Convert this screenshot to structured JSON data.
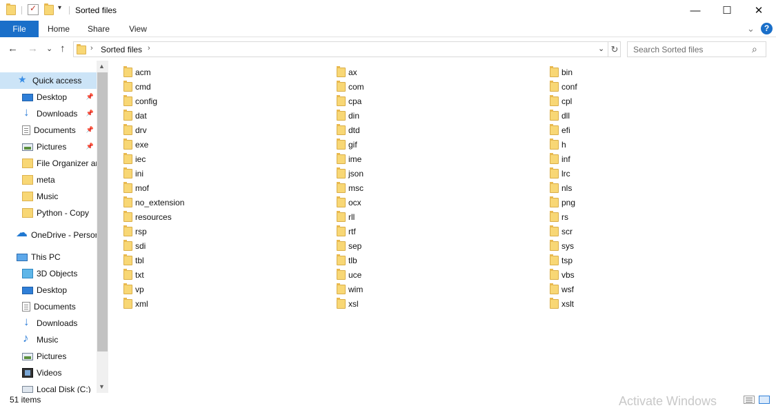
{
  "window": {
    "title": "Sorted files",
    "minimize": "—",
    "maximize": "☐",
    "close": "✕"
  },
  "quick_access_toolbar": {
    "dropdown": "▾"
  },
  "ribbon": {
    "tabs": [
      {
        "label": "File"
      },
      {
        "label": "Home"
      },
      {
        "label": "Share"
      },
      {
        "label": "View"
      }
    ],
    "expand": "⌄",
    "help": "?"
  },
  "navigation": {
    "back": "←",
    "forward": "→",
    "recent": "⌄",
    "up": "↑"
  },
  "address_bar": {
    "separator": "›",
    "breadcrumb": "Sorted files",
    "trailing_separator": "›",
    "dropdown": "⌄",
    "refresh": "↻"
  },
  "search": {
    "placeholder": "Search Sorted files",
    "icon": "⌕"
  },
  "nav_pane": {
    "scroll_up": "▲",
    "scroll_down": "▼",
    "items": [
      {
        "label": "Quick access",
        "icon": "star-icon",
        "selected": true
      },
      {
        "label": "Desktop",
        "icon": "desktop-icon",
        "pinned": true
      },
      {
        "label": "Downloads",
        "icon": "downloads-icon",
        "pinned": true
      },
      {
        "label": "Documents",
        "icon": "documents-icon",
        "pinned": true
      },
      {
        "label": "Pictures",
        "icon": "pictures-icon",
        "pinned": true
      },
      {
        "label": "File Organizer ar",
        "icon": "folder-icon"
      },
      {
        "label": "meta",
        "icon": "folder-icon"
      },
      {
        "label": "Music",
        "icon": "folder-icon"
      },
      {
        "label": "Python - Copy",
        "icon": "folder-icon"
      },
      {
        "label": "OneDrive - Persor",
        "icon": "onedrive-icon"
      },
      {
        "label": "This PC",
        "icon": "this-pc-icon"
      },
      {
        "label": "3D Objects",
        "icon": "3d-objects-icon"
      },
      {
        "label": "Desktop",
        "icon": "desktop-icon"
      },
      {
        "label": "Documents",
        "icon": "documents-icon"
      },
      {
        "label": "Downloads",
        "icon": "downloads-icon"
      },
      {
        "label": "Music",
        "icon": "music-icon"
      },
      {
        "label": "Pictures",
        "icon": "pictures-icon"
      },
      {
        "label": "Videos",
        "icon": "videos-icon"
      },
      {
        "label": "Local Disk (C:)",
        "icon": "disk-icon"
      }
    ],
    "pin_glyph": "📌"
  },
  "files": {
    "column1": [
      "acm",
      "cmd",
      "config",
      "dat",
      "drv",
      "exe",
      "iec",
      "ini",
      "mof",
      "no_extension",
      "resources",
      "rsp",
      "sdi",
      "tbl",
      "txt",
      "vp",
      "xml"
    ],
    "column2": [
      "ax",
      "com",
      "cpa",
      "din",
      "dtd",
      "gif",
      "ime",
      "json",
      "msc",
      "ocx",
      "rll",
      "rtf",
      "sep",
      "tlb",
      "uce",
      "wim",
      "xsl"
    ],
    "column3": [
      "bin",
      "conf",
      "cpl",
      "dll",
      "efi",
      "h",
      "inf",
      "lrc",
      "nls",
      "png",
      "rs",
      "scr",
      "sys",
      "tsp",
      "vbs",
      "wsf",
      "xslt"
    ]
  },
  "status_bar": {
    "item_count": "51 items",
    "watermark": "Activate Windows"
  },
  "colors": {
    "file_tab": "#1a6fc9",
    "selection": "#cce4f7",
    "folder": "#f8d775"
  }
}
